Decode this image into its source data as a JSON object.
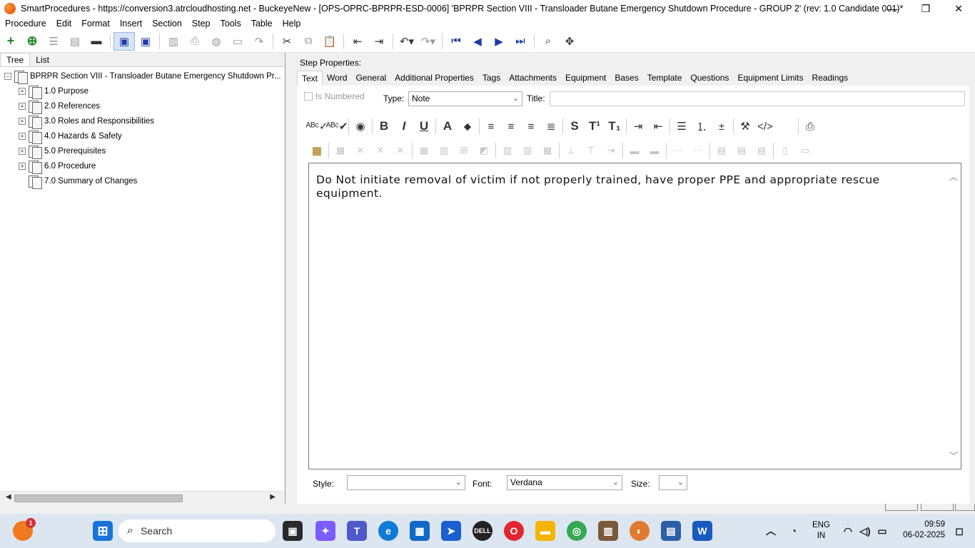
{
  "window": {
    "title": "SmartProcedures - https://conversion3.atrcloudhosting.net - BuckeyeNew - [OPS-OPRC-BPRPR-ESD-0006] 'BPRPR Section VIII - Transloader Butane Emergency Shutdown Procedure - GROUP 2' (rev: 1.0 Candidate 001)*",
    "minimize": "—",
    "restore": "❐",
    "close": "✕"
  },
  "menu": [
    "Procedure",
    "Edit",
    "Format",
    "Insert",
    "Section",
    "Step",
    "Tools",
    "Table",
    "Help"
  ],
  "left": {
    "tabs": [
      "Tree",
      "List"
    ],
    "root": "BPRPR Section VIII - Transloader Butane Emergency Shutdown Pr...",
    "items": [
      {
        "label": "1.0 Purpose",
        "expander": "+"
      },
      {
        "label": "2.0 References",
        "expander": "+"
      },
      {
        "label": "3.0 Roles and Responsibilities",
        "expander": "+"
      },
      {
        "label": "4.0 Hazards & Safety",
        "expander": "+"
      },
      {
        "label": "5.0 Prerequisites",
        "expander": "+"
      },
      {
        "label": "6.0 Procedure",
        "expander": "+"
      },
      {
        "label": "7.0 Summary of Changes",
        "expander": ""
      }
    ],
    "root_expander": "−"
  },
  "right": {
    "heading": "Step Properties:",
    "tabs": [
      "Text",
      "Word",
      "General",
      "Additional Properties",
      "Tags",
      "Attachments",
      "Equipment",
      "Bases",
      "Template",
      "Questions",
      "Equipment Limits",
      "Readings"
    ],
    "is_numbered_label": "Is Numbered",
    "type_label": "Type:",
    "type_value": "Note",
    "title_label": "Title:",
    "title_value": "",
    "editor_text": "Do Not initiate removal of victim if not properly trained, have proper PPE and appropriate rescue equipment.",
    "style_label": "Style:",
    "style_value": "",
    "font_label": "Font:",
    "font_value": "Verdana",
    "size_label": "Size:",
    "size_value": ""
  },
  "taskbar": {
    "search_placeholder": "Search",
    "notif_badge": "1",
    "lang_line1": "ENG",
    "lang_line2": "IN",
    "time": "09:59",
    "date": "06-02-2025"
  },
  "icons": {
    "toolbar": [
      "add-icon",
      "add-child-icon",
      "collapse-icon",
      "expand-icon",
      "remove-icon",
      "save-all-icon",
      "save-icon",
      "export-icon",
      "print-icon",
      "spellcheck-icon",
      "preview-icon",
      "redo-gray-icon",
      "cut-icon",
      "copy-icon",
      "paste-icon",
      "outdent-icon",
      "indent-icon",
      "undo-icon",
      "redo-icon",
      "first-icon",
      "previous-icon",
      "next-icon",
      "last-icon",
      "find-icon",
      "move-icon"
    ],
    "accent": "#1e3aa8"
  }
}
